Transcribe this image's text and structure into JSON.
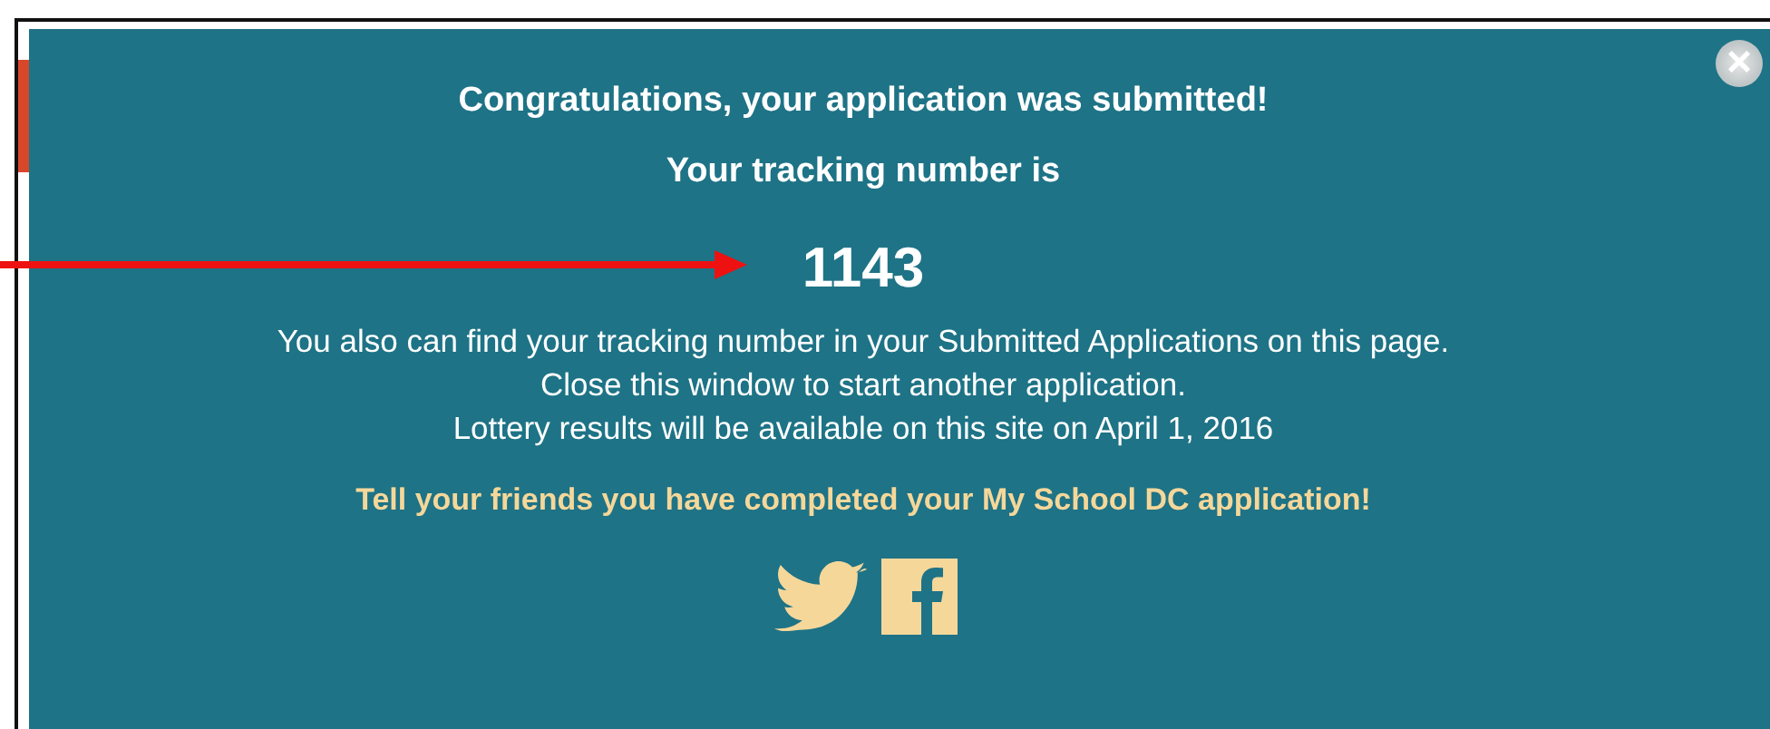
{
  "dialog": {
    "close": "×",
    "title": "Congratulations, your application was submitted!",
    "tracking_label": "Your tracking number is",
    "tracking_number": "1143",
    "messages": [
      "You also can find your tracking number in your Submitted Applications on this page.",
      "Close this window to start another application.",
      "Lottery results will be available on this site on April 1, 2016"
    ],
    "share_text": "Tell your friends you have completed your My School DC application!",
    "share_links": [
      {
        "kind": "twitter"
      },
      {
        "kind": "facebook"
      }
    ]
  }
}
